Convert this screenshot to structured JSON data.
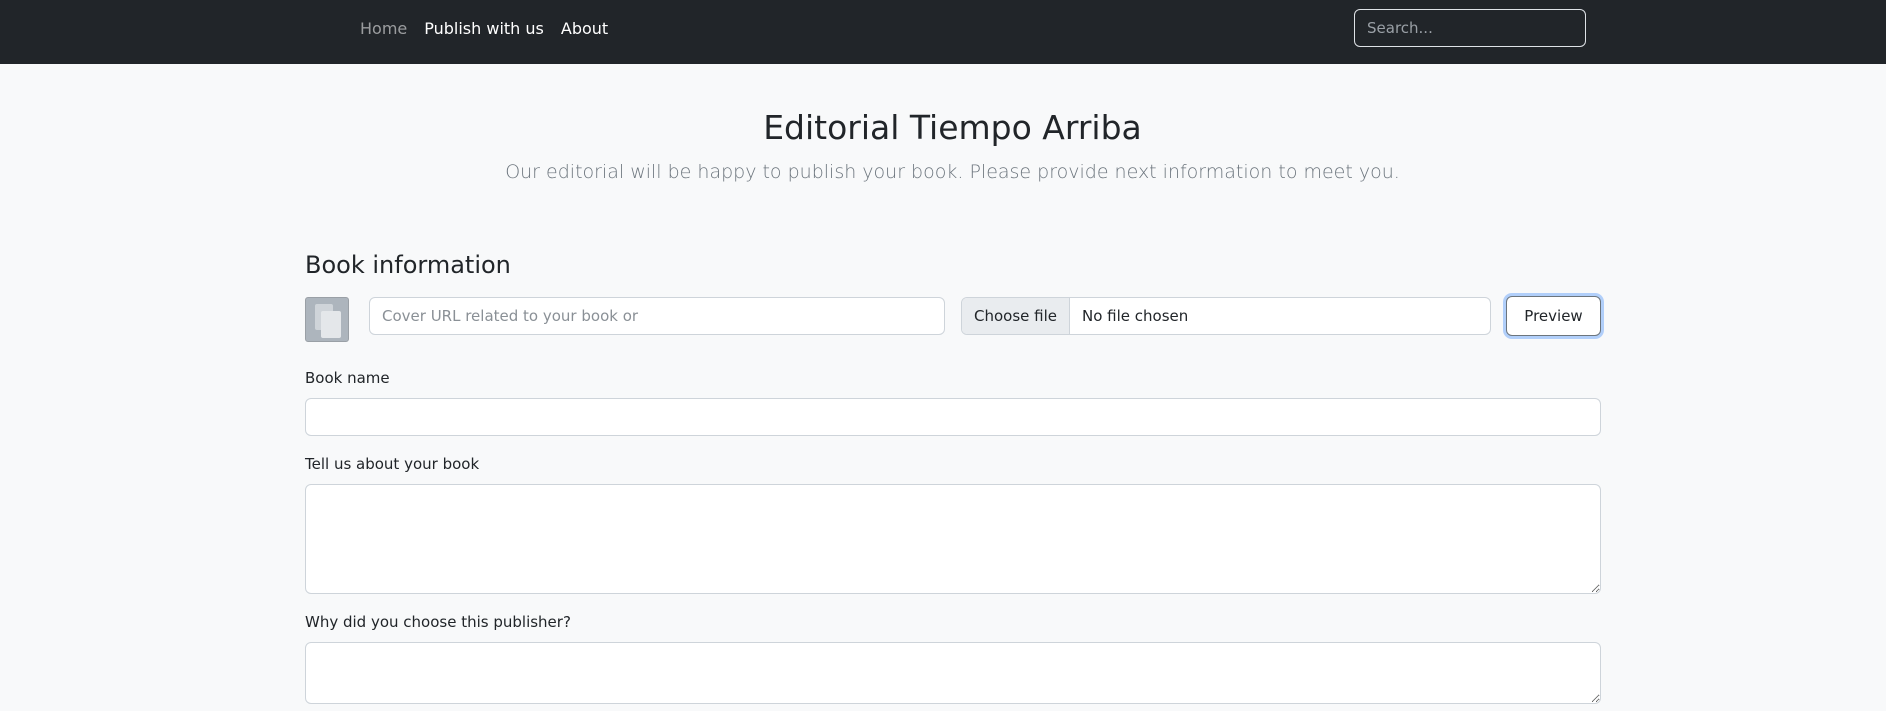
{
  "navbar": {
    "links": [
      {
        "label": "Home"
      },
      {
        "label": "Publish with us"
      },
      {
        "label": "About"
      }
    ],
    "search_placeholder": "Search..."
  },
  "hero": {
    "title": "Editorial Tiempo Arriba",
    "subtitle": "Our editorial will be happy to publish your book. Please provide next information to meet you."
  },
  "form": {
    "section_title": "Book information",
    "cover_url_placeholder": "Cover URL related to your book or",
    "cover_url_value": "",
    "file_button_label": "Choose file",
    "file_status": "No file chosen",
    "preview_label": "Preview",
    "book_name_label": "Book name",
    "book_name_value": "",
    "about_label": "Tell us about your book",
    "about_value": "",
    "why_label": "Why did you choose this publisher?",
    "why_value": ""
  },
  "colors": {
    "navbar_bg": "#212529",
    "page_bg": "#f8f9fa",
    "focus_ring": "#0d6efd"
  }
}
